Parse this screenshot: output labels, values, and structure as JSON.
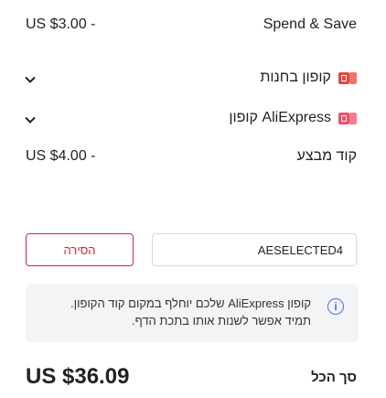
{
  "top_row": {
    "price": "US $3.00 -",
    "label": "Spend & Save"
  },
  "store_coupon": {
    "label": "קופון בחנות"
  },
  "aliexpress_coupon": {
    "label": "AliExpress קופון"
  },
  "promo_code_row": {
    "price": "US $4.00 -",
    "label": "קוד מבצע"
  },
  "promo": {
    "cancel_label": "הסירה",
    "code_value": "AESELECTED4"
  },
  "info": {
    "text": "קופון AliExpress שלכם יוחלף במקום קוד הקופון. תמיד אפשר לשנות אותו בתכת הדף."
  },
  "totals": {
    "amount": "US $36.09",
    "label": "סך הכל"
  },
  "colors": {
    "accent_red": "#e0203a",
    "info_blue": "#4a6cf7"
  },
  "icons": {
    "store_coupon": "coupon-icon",
    "aliexpress_coupon": "coupon-icon",
    "info": "info-icon",
    "chevron": "chevron-down-icon"
  }
}
